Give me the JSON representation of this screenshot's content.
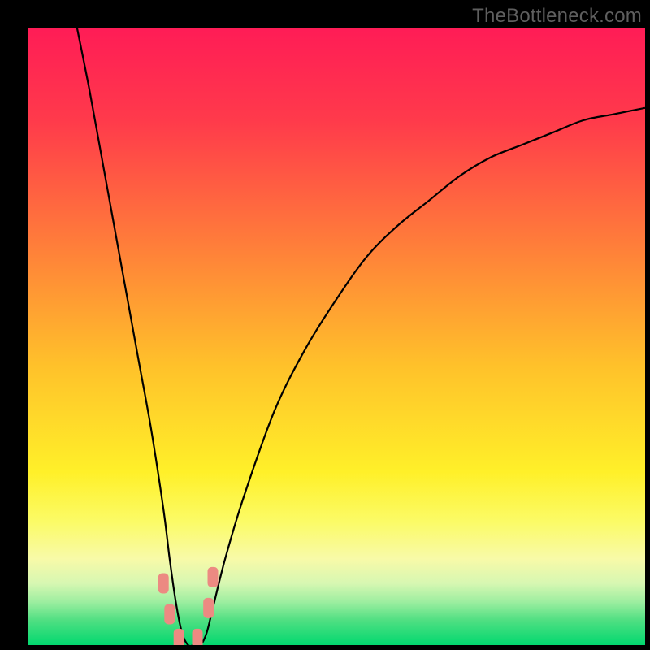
{
  "watermark": "TheBottleneck.com",
  "chart_data": {
    "type": "line",
    "title": "",
    "xlabel": "",
    "ylabel": "",
    "xlim": [
      0,
      100
    ],
    "ylim": [
      0,
      100
    ],
    "series": [
      {
        "name": "bottleneck-curve",
        "x": [
          8,
          10,
          12,
          14,
          16,
          18,
          20,
          22,
          23,
          24,
          25,
          26,
          27,
          28,
          29,
          30,
          32,
          35,
          40,
          45,
          50,
          55,
          60,
          65,
          70,
          75,
          80,
          85,
          90,
          95,
          100
        ],
        "y": [
          100,
          90,
          79,
          68,
          57,
          46,
          35,
          22,
          14,
          7,
          2,
          0,
          0,
          0,
          2,
          6,
          14,
          24,
          38,
          48,
          56,
          63,
          68,
          72,
          76,
          79,
          81,
          83,
          85,
          86,
          87
        ]
      }
    ],
    "markers": [
      {
        "x": 22.0,
        "y": 10
      },
      {
        "x": 23.0,
        "y": 5
      },
      {
        "x": 24.5,
        "y": 1
      },
      {
        "x": 27.5,
        "y": 1
      },
      {
        "x": 29.3,
        "y": 6
      },
      {
        "x": 30.0,
        "y": 11
      }
    ],
    "gradient_stops": [
      {
        "pos": 0.0,
        "color": "#ff1c56"
      },
      {
        "pos": 0.15,
        "color": "#ff3a4b"
      },
      {
        "pos": 0.35,
        "color": "#ff7d3a"
      },
      {
        "pos": 0.55,
        "color": "#ffc22a"
      },
      {
        "pos": 0.72,
        "color": "#fff029"
      },
      {
        "pos": 0.8,
        "color": "#fbfb66"
      },
      {
        "pos": 0.86,
        "color": "#f8faa8"
      },
      {
        "pos": 0.9,
        "color": "#d7f7b2"
      },
      {
        "pos": 0.93,
        "color": "#9deea0"
      },
      {
        "pos": 0.96,
        "color": "#4fdf82"
      },
      {
        "pos": 1.0,
        "color": "#02d86f"
      }
    ],
    "marker_style": {
      "fill": "#ec8a82",
      "rx": 5,
      "w": 13,
      "h": 25
    }
  }
}
